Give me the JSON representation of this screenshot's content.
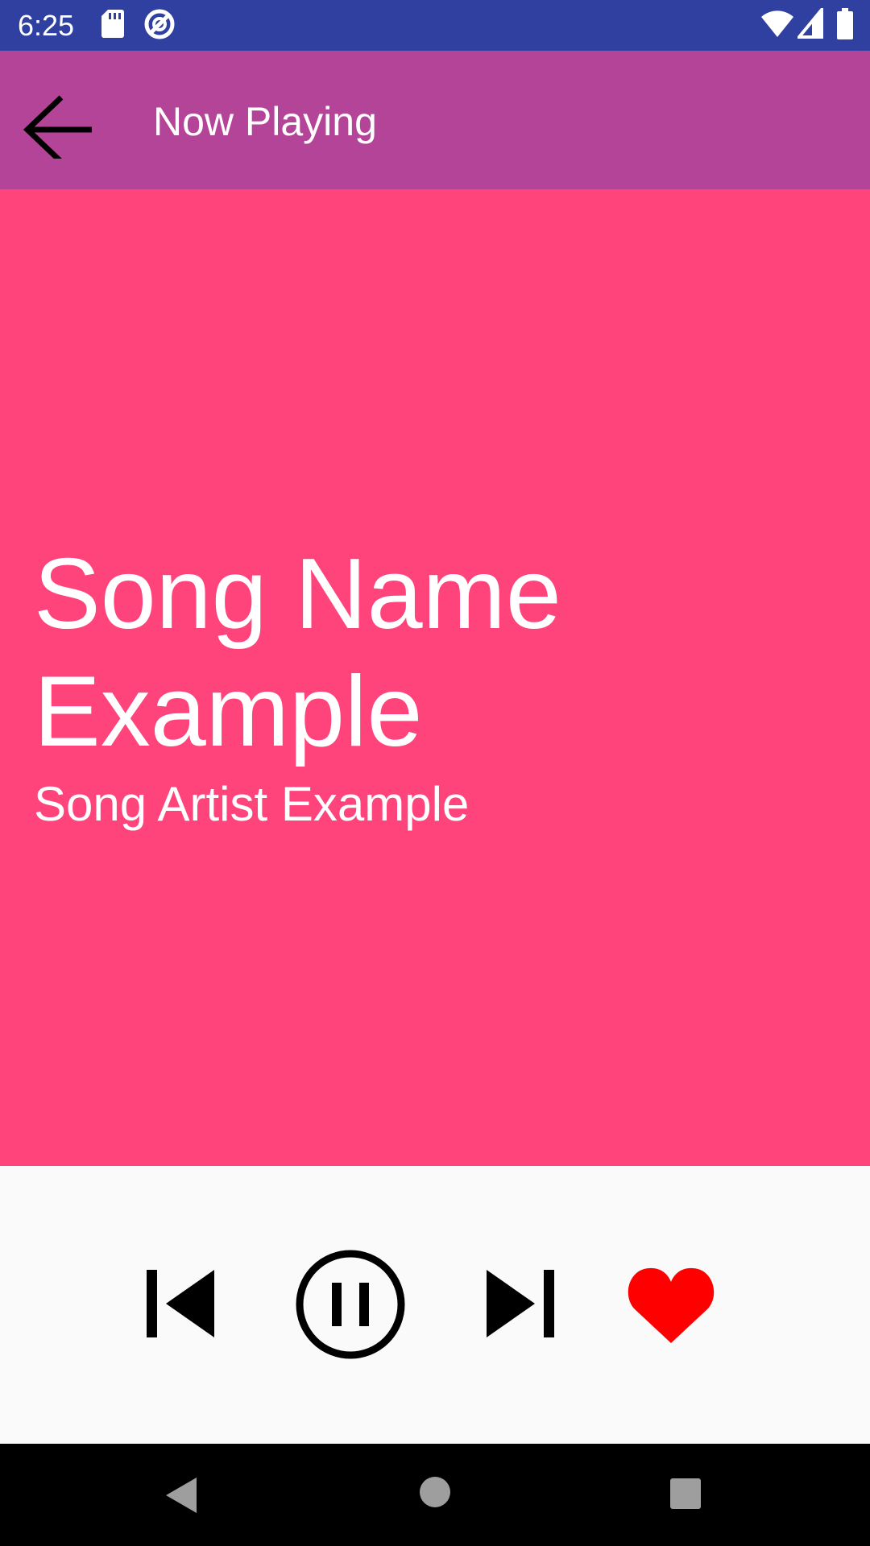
{
  "status_bar": {
    "time": "6:25",
    "icons": [
      "sd-card-icon",
      "data-saver-icon",
      "wifi-icon",
      "cell-signal-icon",
      "battery-icon"
    ]
  },
  "app_bar": {
    "title": "Now Playing",
    "back_icon": "arrow-back-icon",
    "color": "#b44498"
  },
  "now_playing": {
    "song_name": "Song Name Example",
    "song_artist": "Song Artist Example",
    "background_color": "#ff437b"
  },
  "controls": {
    "buttons": [
      "skip-previous-icon",
      "pause-circle-icon",
      "skip-next-icon",
      "heart-icon"
    ],
    "favorite_color": "#ff0000"
  },
  "nav_bar": {
    "buttons": [
      "back-triangle-icon",
      "home-circle-icon",
      "recents-square-icon"
    ]
  }
}
